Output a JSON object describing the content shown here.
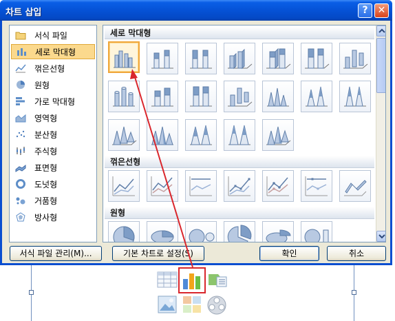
{
  "dialog": {
    "title": "차트 삽입",
    "help_glyph": "?",
    "close_glyph": "✕"
  },
  "categories": [
    {
      "label": "서식 파일",
      "icon": "folder-icon"
    },
    {
      "label": "세로 막대형",
      "icon": "column-chart-icon",
      "selected": true
    },
    {
      "label": "꺾은선형",
      "icon": "line-chart-icon"
    },
    {
      "label": "원형",
      "icon": "pie-chart-icon"
    },
    {
      "label": "가로 막대형",
      "icon": "bar-chart-icon"
    },
    {
      "label": "영역형",
      "icon": "area-chart-icon"
    },
    {
      "label": "분산형",
      "icon": "scatter-chart-icon"
    },
    {
      "label": "주식형",
      "icon": "stock-chart-icon"
    },
    {
      "label": "표면형",
      "icon": "surface-chart-icon"
    },
    {
      "label": "도넛형",
      "icon": "donut-chart-icon"
    },
    {
      "label": "거품형",
      "icon": "bubble-chart-icon"
    },
    {
      "label": "방사형",
      "icon": "radar-chart-icon"
    }
  ],
  "sections": {
    "column": "세로 막대형",
    "line": "꺾은선형",
    "pie": "원형"
  },
  "buttons": {
    "manage_templates": "서식 파일 관리(M)...",
    "set_default": "기본 차트로 설정(S)",
    "ok": "확인",
    "cancel": "취소"
  },
  "colors": {
    "accent": "#0552d6",
    "selection": "#fbd98d",
    "annotation": "#d9262c"
  }
}
